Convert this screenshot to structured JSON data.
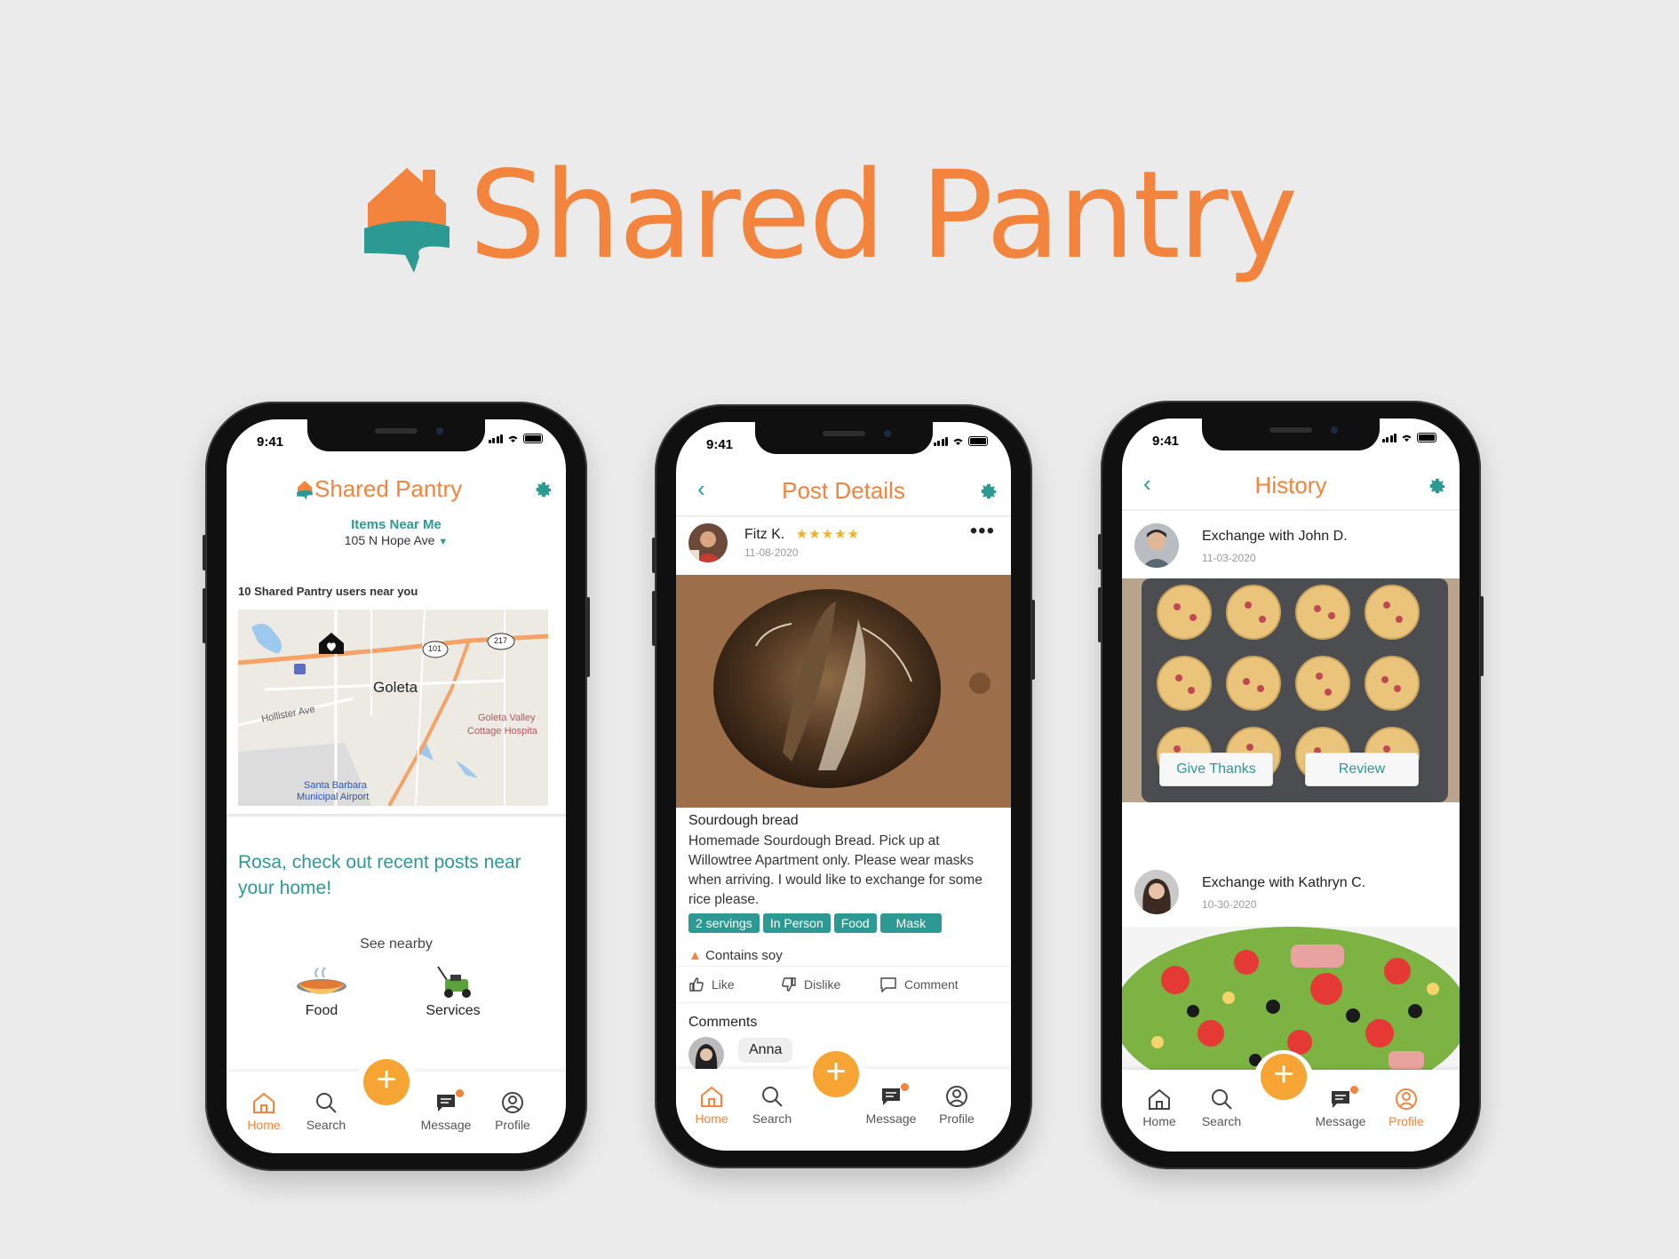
{
  "brand": {
    "title": "Shared Pantry"
  },
  "colors": {
    "orange": "#f2843d",
    "teal": "#2c9a93",
    "fab": "#f6a534"
  },
  "status": {
    "time": "9:41"
  },
  "nav": {
    "home": "Home",
    "search": "Search",
    "message": "Message",
    "profile": "Profile",
    "add": "+"
  },
  "home_screen": {
    "app_title": "Shared Pantry",
    "items_near_me": "Items Near Me",
    "address": "105 N Hope Ave",
    "users_near": "10 Shared Pantry users near you",
    "map": {
      "labels": {
        "goleta": "Goleta",
        "hollister": "Hollister Ave",
        "hospital_1": "Goleta Valley",
        "hospital_2": "Cottage Hospita",
        "airport_1": "Santa Barbara",
        "airport_2": "Municipal Airport",
        "hw101": "101",
        "hw217": "217"
      }
    },
    "greeting": "Rosa, check out recent posts near your home!",
    "see_nearby": "See nearby",
    "categories": [
      "Food",
      "Services"
    ]
  },
  "post_screen": {
    "title": "Post Details",
    "author": "Fitz K.",
    "rating_stars": "★★★★★",
    "rating_value": 4.5,
    "date": "11-08-2020",
    "more": "•••",
    "post_title": "Sourdough bread",
    "description": "Homemade Sourdough Bread. Pick up at Willowtree Apartment only. Please wear masks when arriving. I would like to exchange for some rice please.",
    "tags": [
      "2 servings",
      "In Person",
      "Food",
      "Mask"
    ],
    "allergen": "Contains soy",
    "actions": {
      "like": "Like",
      "dislike": "Dislike",
      "comment": "Comment"
    },
    "comments_label": "Comments",
    "commenter": "Anna"
  },
  "history_screen": {
    "title": "History",
    "exchange_1": {
      "title": "Exchange with John D.",
      "date": "11-03-2020"
    },
    "give_thanks": "Give Thanks",
    "review": "Review",
    "exchange_2": {
      "title": "Exchange with Kathryn C.",
      "date": "10-30-2020"
    }
  }
}
